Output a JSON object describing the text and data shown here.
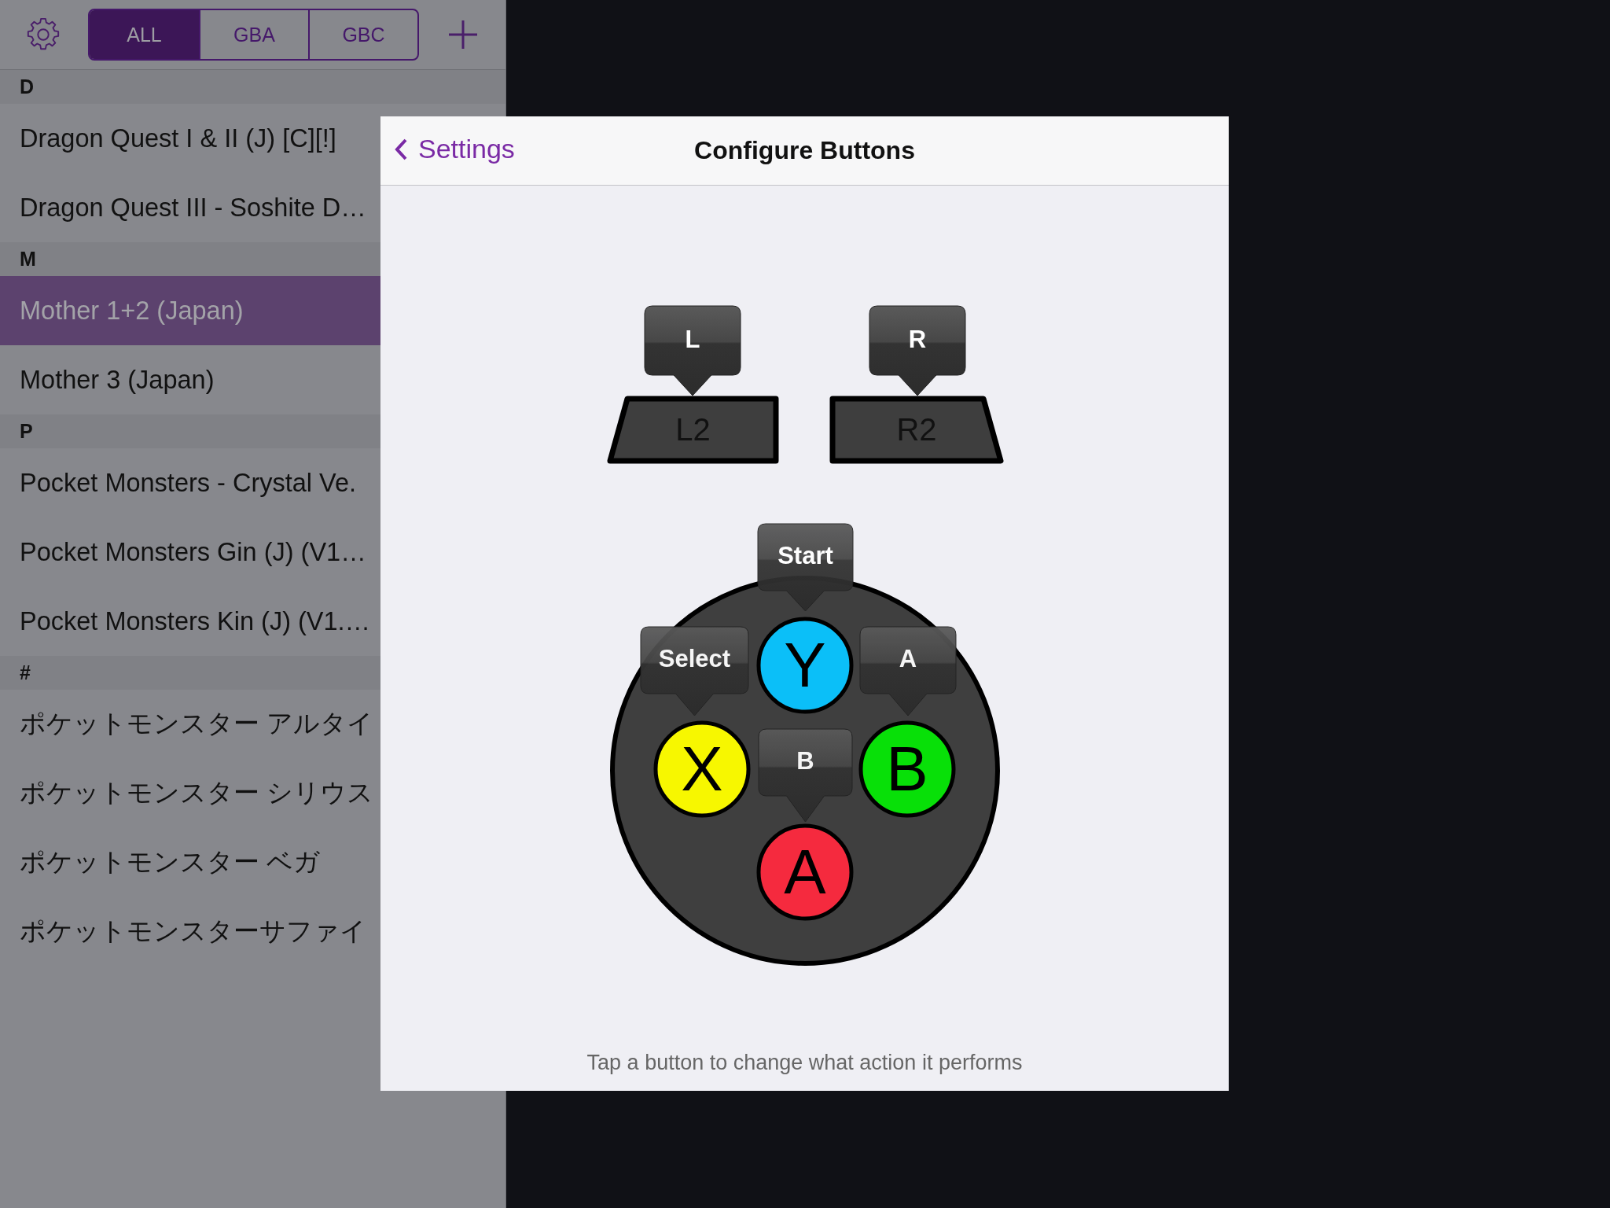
{
  "toolbar": {
    "filters": [
      {
        "label": "ALL",
        "selected": true
      },
      {
        "label": "GBA",
        "selected": false
      },
      {
        "label": "GBC",
        "selected": false
      }
    ]
  },
  "library": {
    "sections": [
      {
        "header": "D",
        "games": [
          {
            "title": "Dragon Quest I & II (J) [C][!]",
            "selected": false
          },
          {
            "title": "Dragon Quest III - Soshite D…",
            "selected": false
          }
        ]
      },
      {
        "header": "M",
        "games": [
          {
            "title": "Mother 1+2 (Japan)",
            "selected": true
          },
          {
            "title": "Mother 3 (Japan)",
            "selected": false
          }
        ]
      },
      {
        "header": "P",
        "games": [
          {
            "title": "Pocket Monsters - Crystal Ve.",
            "selected": false
          },
          {
            "title": "Pocket Monsters Gin (J) (V1…",
            "selected": false
          },
          {
            "title": "Pocket Monsters Kin (J) (V1.…",
            "selected": false
          }
        ]
      },
      {
        "header": "#",
        "games": [
          {
            "title": "ポケットモンスター アルタイ",
            "selected": false
          },
          {
            "title": "ポケットモンスター シリウス",
            "selected": false
          },
          {
            "title": "ポケットモンスター ベガ",
            "selected": false
          },
          {
            "title": "ポケットモンスターサファイ",
            "selected": false
          }
        ]
      }
    ]
  },
  "dialog": {
    "back": "Settings",
    "title": "Configure Buttons",
    "shoulders": [
      {
        "mapping": "L",
        "button": "L2"
      },
      {
        "mapping": "R",
        "button": "R2"
      }
    ],
    "face_buttons": [
      {
        "mapping": "Start",
        "button": "Y",
        "color": "#0bbff8"
      },
      {
        "mapping": "Select",
        "button": "X",
        "color": "#f7f700"
      },
      {
        "mapping": "A",
        "button": "B",
        "color": "#08e008"
      },
      {
        "mapping": "B",
        "button": "A",
        "color": "#f52a3e"
      }
    ],
    "hint": "Tap a button to change what action it performs"
  }
}
